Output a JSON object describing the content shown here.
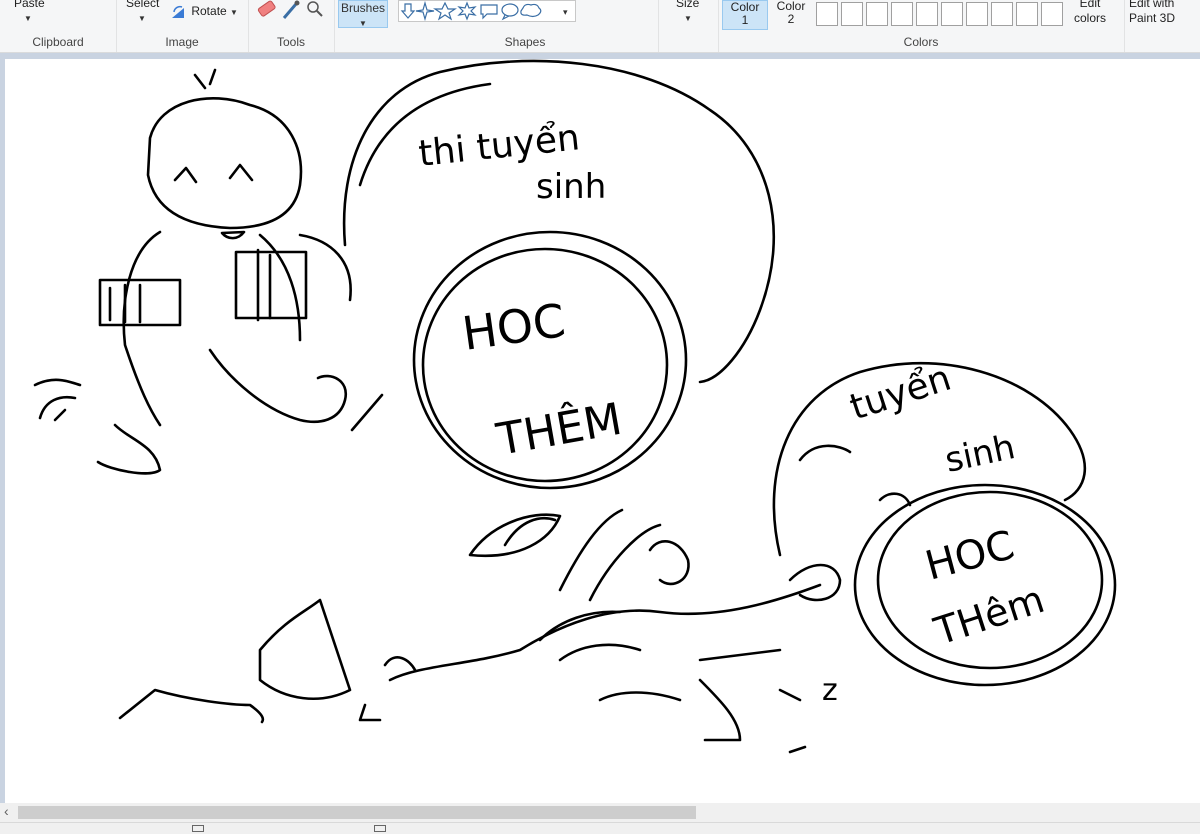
{
  "ribbon": {
    "clipboard": {
      "paste_label": "Paste",
      "group_label": "Clipboard"
    },
    "image": {
      "select_label": "Select",
      "rotate_label": "Rotate",
      "group_label": "Image"
    },
    "tools": {
      "group_label": "Tools"
    },
    "brushes": {
      "label": "Brushes"
    },
    "shapes": {
      "group_label": "Shapes"
    },
    "size": {
      "label": "Size"
    },
    "colors": {
      "color1_label": "Color",
      "color1_number": "1",
      "color2_label": "Color",
      "color2_number": "2",
      "edit_colors_label_1": "Edit",
      "edit_colors_label_2": "colors",
      "group_label": "Colors"
    },
    "paint3d": {
      "label_1": "Edit with",
      "label_2": "Paint 3D"
    }
  },
  "canvas": {
    "drawing_text": {
      "big_rock_line1": "thi tuyển",
      "big_rock_line2": "sinh",
      "big_small_rock_line1": "HOC",
      "big_small_rock_line2": "THÊM",
      "small_rock_line1": "tuyển",
      "small_rock_line2": "sinh",
      "small_small_rock_line1": "HOC",
      "small_small_rock_line2": "THêm",
      "sleep_mark": "z"
    }
  },
  "colors": {
    "accent": "#cce4f7",
    "workspace_bg": "#c9d3e1",
    "ribbon_bg": "#f5f6f7"
  }
}
